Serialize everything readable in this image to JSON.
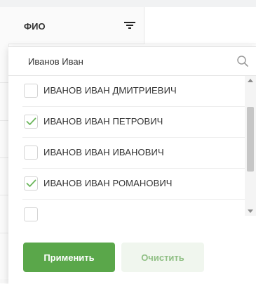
{
  "column": {
    "title": "ФИО",
    "filter_icon": "filter-lines-icon"
  },
  "filter": {
    "search": {
      "value": "Иванов Иван",
      "placeholder": "",
      "icon": "search-icon"
    },
    "items": [
      {
        "label": "ИВАНОВ ИВАН ДМИТРИЕВИЧ",
        "checked": false
      },
      {
        "label": "ИВАНОВ ИВАН ПЕТРОВИЧ",
        "checked": true
      },
      {
        "label": "ИВАНОВ ИВАН ИВАНОВИЧ",
        "checked": false
      },
      {
        "label": "ИВАНОВ ИВАН РОМАНОВИЧ",
        "checked": true
      },
      {
        "label": "",
        "checked": false
      }
    ],
    "apply_label": "Применить",
    "clear_label": "Очистить"
  },
  "colors": {
    "accent": "#5aa74a",
    "check": "#6bb65b",
    "clear_bg": "#f0f6ee",
    "clear_text": "#8fbf84"
  }
}
